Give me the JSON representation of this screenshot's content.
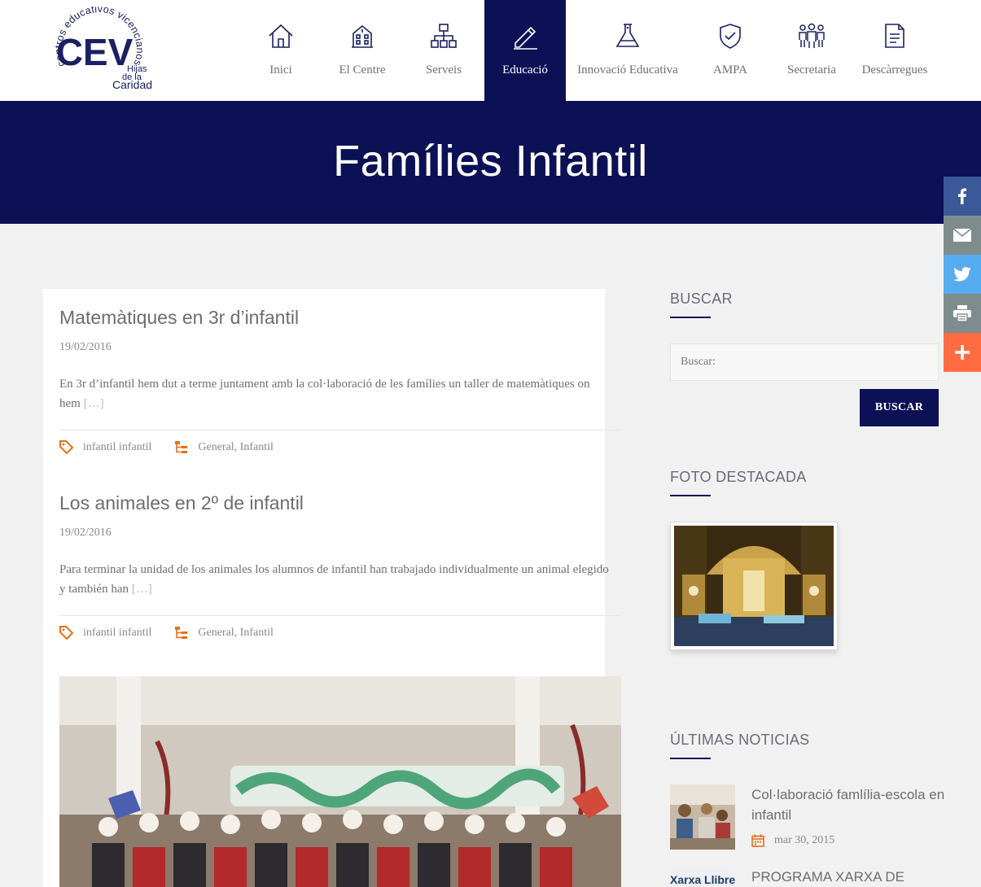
{
  "logo": {
    "ring_text": "centros educativos vicencianos",
    "monogram": "CEV",
    "sub1": "Hijas",
    "sub2": "de la",
    "sub3": "Caridad"
  },
  "nav": [
    {
      "label": "Inici",
      "icon": "home-icon"
    },
    {
      "label": "El Centre",
      "icon": "building-icon"
    },
    {
      "label": "Serveis",
      "icon": "sitemap-icon"
    },
    {
      "label": "Educació",
      "icon": "pencil-icon",
      "active": true
    },
    {
      "label": "Innovació Educativa",
      "icon": "flask-icon"
    },
    {
      "label": "AMPA",
      "icon": "shield-icon"
    },
    {
      "label": "Secretaria",
      "icon": "people-icon"
    },
    {
      "label": "Descàrregues",
      "icon": "document-icon"
    }
  ],
  "page_title": "Famílies Infantil",
  "social": [
    {
      "name": "facebook-icon",
      "color": "#3b5998"
    },
    {
      "name": "email-icon",
      "color": "#7f8c8d"
    },
    {
      "name": "twitter-icon",
      "color": "#55acee"
    },
    {
      "name": "print-icon",
      "color": "#7f8c8d"
    },
    {
      "name": "plus-icon",
      "color": "#ff6c42"
    }
  ],
  "posts": [
    {
      "title": "Matemàtiques en 3r d’infantil",
      "date": "19/02/2016",
      "excerpt": "En 3r d’infantil hem dut a terme juntament amb la col·laboració de les famílies un taller de matemàtiques on hem",
      "more": "[…]",
      "tags": "infantil infantil",
      "categories": "General, Infantil"
    },
    {
      "title": "Los animales en 2º de infantil",
      "date": "19/02/2016",
      "excerpt": "Para terminar la unidad de los animales los alumnos de infantil han trabajado individualmente un animal elegido  y también han",
      "more": "[…]",
      "tags": "infantil infantil",
      "categories": "General, Infantil"
    }
  ],
  "sidebar": {
    "search_title": "BUSCAR",
    "search_placeholder": "Buscar:",
    "search_button": "BUSCAR",
    "photo_title": "FOTO DESTACADA",
    "news_title": "ÚLTIMAS NOTICIAS",
    "news": [
      {
        "title": "Col·laboració famlília-escola en infantil",
        "date": "mar 30, 2015"
      },
      {
        "title": "PROGRAMA XARXA DE",
        "date": ""
      }
    ],
    "news_thumb2_text": "Xarxa Llibre"
  },
  "colors": {
    "navy": "#0c1156",
    "accent_orange": "#e8701a"
  }
}
